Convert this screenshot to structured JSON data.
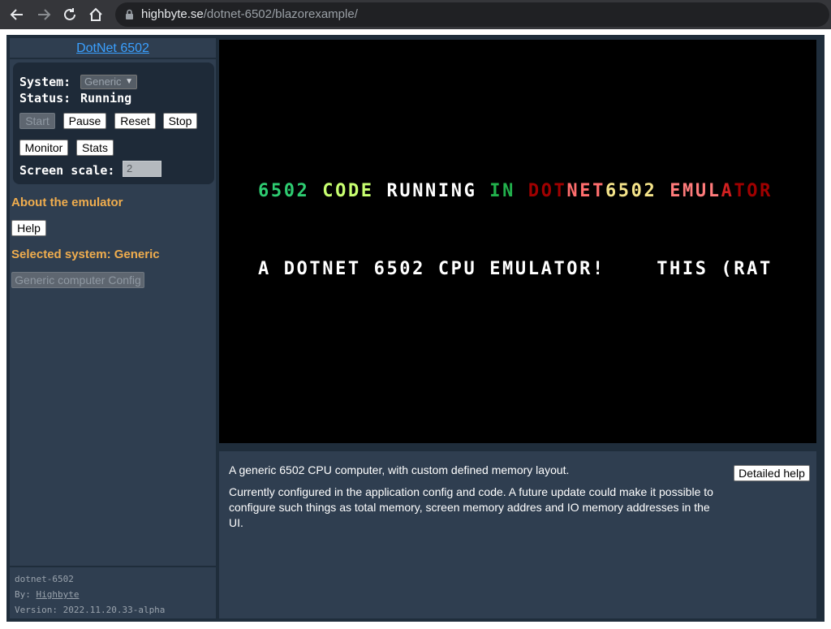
{
  "browser": {
    "url_host": "highbyte.se",
    "url_path": "/dotnet-6502/blazorexample/"
  },
  "sidebar": {
    "title": "DotNet 6502",
    "system_label": "System:",
    "system_value": "Generic",
    "status_label": "Status:",
    "status_value": "Running",
    "buttons": {
      "start": "Start",
      "pause": "Pause",
      "reset": "Reset",
      "stop": "Stop",
      "monitor": "Monitor",
      "stats": "Stats"
    },
    "screen_scale_label": "Screen scale:",
    "screen_scale_value": "2",
    "about_heading": "About the emulator",
    "help_button": "Help",
    "selected_system_heading": "Selected system: Generic",
    "config_button": "Generic computer Config",
    "footer": {
      "project_link": "dotnet-6502",
      "by_label": "By:",
      "author_link": "Highbyte",
      "version": "Version: 2022.11.20.33-alpha"
    }
  },
  "screen": {
    "line1_segments": [
      {
        "text": "6502",
        "color": "#2ecc71"
      },
      {
        "text": " ",
        "color": "#ffffff"
      },
      {
        "text": "CODE",
        "color": "#c8ff70"
      },
      {
        "text": " ",
        "color": "#ffffff"
      },
      {
        "text": "RUNNING",
        "color": "#ffffff"
      },
      {
        "text": " ",
        "color": "#ffffff"
      },
      {
        "text": "IN",
        "color": "#22b14c"
      },
      {
        "text": " ",
        "color": "#ffffff"
      },
      {
        "text": "DOT",
        "color": "#a00000"
      },
      {
        "text": "NET",
        "color": "#ff6e6e"
      },
      {
        "text": "6502",
        "color": "#f5e48a"
      },
      {
        "text": " ",
        "color": "#ffffff"
      },
      {
        "text": "EMUL",
        "color": "#ff7b7b"
      },
      {
        "text": "A",
        "color": "#d22020"
      },
      {
        "text": "TOR",
        "color": "#a00000"
      }
    ],
    "line2": "A DOTNET 6502 CPU EMULATOR!    THIS (RAT",
    "line2_color": "#ffffff"
  },
  "info": {
    "description": "A generic 6502 CPU computer, with custom defined memory layout.",
    "config_note": "Currently configured in the application config and code. A future update could make it possible to configure such things as total memory, screen memory addres and IO memory addresses in the UI.",
    "detailed_help_button": "Detailed help"
  }
}
